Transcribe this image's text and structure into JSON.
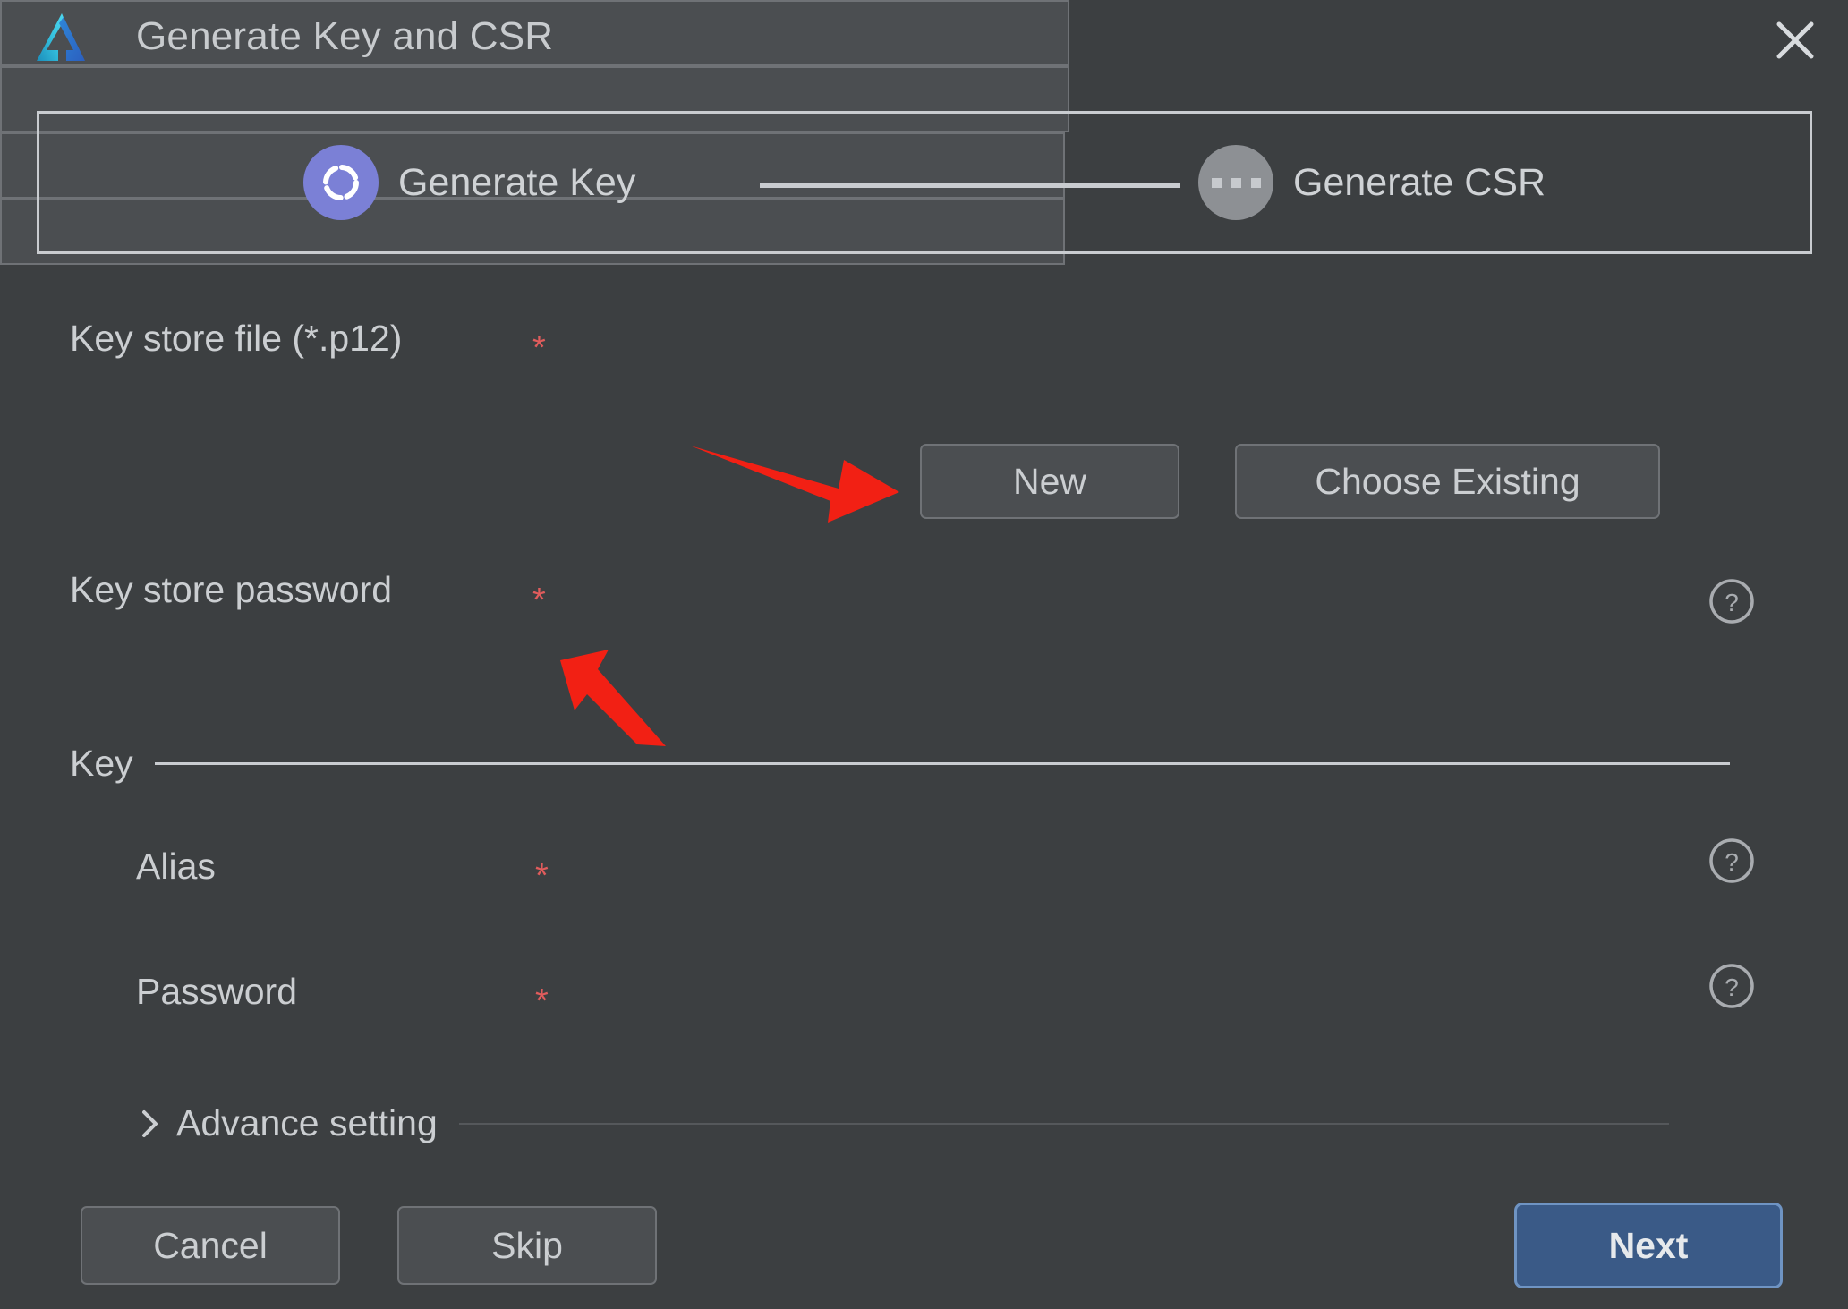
{
  "window": {
    "title": "Generate Key and CSR",
    "logo_icon": "autodesk-triangle-logo-icon",
    "close_icon": "close-icon"
  },
  "stepper": {
    "steps": [
      {
        "label": "Generate Key",
        "state": "active",
        "icon": "spinner-ring-icon",
        "color": "#7b80d6"
      },
      {
        "label": "Generate CSR",
        "state": "pending",
        "icon": "ellipsis-icon",
        "color": "#8d9094"
      }
    ]
  },
  "form": {
    "key_store_file": {
      "label": "Key store file (*.p12)",
      "required_marker": "*",
      "value": "",
      "placeholder": ""
    },
    "buttons": {
      "new_label": "New",
      "choose_existing_label": "Choose Existing"
    },
    "key_store_password": {
      "label": "Key store password",
      "required_marker": "*",
      "value": "",
      "placeholder": "",
      "help_icon": "question-circle-icon"
    },
    "key_section": {
      "title": "Key",
      "alias": {
        "label": "Alias",
        "required_marker": "*",
        "value": "",
        "placeholder": "",
        "help_icon": "question-circle-icon"
      },
      "password": {
        "label": "Password",
        "required_marker": "*",
        "value": "",
        "placeholder": "",
        "help_icon": "question-circle-icon"
      }
    },
    "advance_setting": {
      "label": "Advance setting",
      "expanded": false,
      "chevron_icon": "chevron-right-icon"
    }
  },
  "footer": {
    "cancel_label": "Cancel",
    "skip_label": "Skip",
    "next_label": "Next"
  },
  "annotations": {
    "arrow_color": "#f22014",
    "arrow_to_new_button": "arrow-pointing-right-at-new-button",
    "arrow_to_key_store_password": "arrow-pointing-up-left-at-key-store-password-field"
  },
  "colors": {
    "background": "#3c3f41",
    "input_fill": "#4b4e51",
    "input_border": "#6f7276",
    "text": "#cbced1",
    "required_asterisk": "#e05c5c",
    "primary_button": "#3a5a87",
    "primary_button_border": "#6f94c3",
    "stepper_border": "#c9ccd0"
  }
}
